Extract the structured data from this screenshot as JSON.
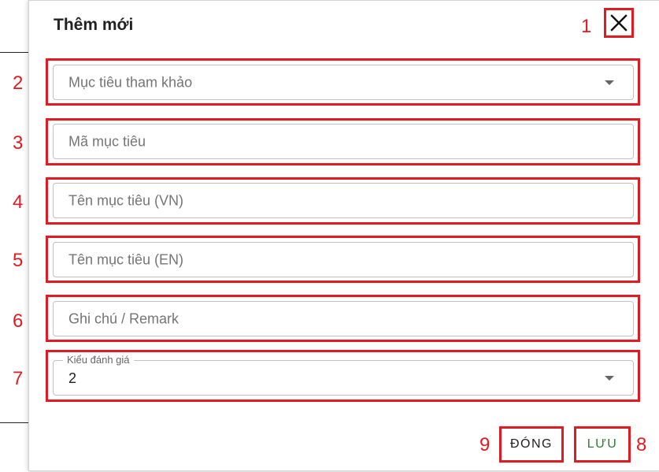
{
  "dialog": {
    "title": "Thêm mới"
  },
  "fields": {
    "reference_target": {
      "placeholder": "Mục tiêu tham khảo"
    },
    "target_code": {
      "placeholder": "Mã mục tiêu"
    },
    "target_name_vn": {
      "placeholder": "Tên mục tiêu (VN)"
    },
    "target_name_en": {
      "placeholder": "Tên mục tiêu (EN)"
    },
    "remark": {
      "placeholder": "Ghi chú / Remark"
    },
    "evaluation_type": {
      "label": "Kiểu đánh giá",
      "value": "2"
    }
  },
  "buttons": {
    "close_label": "ĐÓNG",
    "save_label": "LƯU"
  },
  "annotations": {
    "n1": "1",
    "n2": "2",
    "n3": "3",
    "n4": "4",
    "n5": "5",
    "n6": "6",
    "n7": "7",
    "n8": "8",
    "n9": "9"
  },
  "colors": {
    "annotation": "#e21a22",
    "save_text": "#2e7d32",
    "close_text": "#212121"
  },
  "icons": {
    "close": "close-icon",
    "dropdown": "caret-down-icon"
  }
}
